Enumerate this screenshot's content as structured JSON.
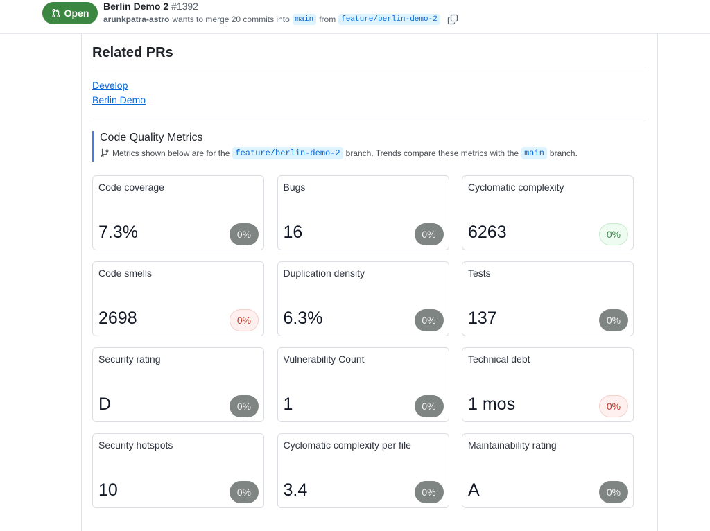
{
  "header": {
    "state": "Open",
    "state_icon": "git-pull-request-icon",
    "title": "Berlin Demo 2",
    "number": "#1392",
    "author": "arunkpatra-astro",
    "merge_text": "wants to merge 20 commits into",
    "base_branch": "main",
    "from_text": "from",
    "head_branch": "feature/berlin-demo-2",
    "copy_icon": "copy-icon"
  },
  "related": {
    "title": "Related PRs",
    "links": [
      "Develop",
      "Berlin Demo"
    ]
  },
  "code_quality": {
    "title": "Code Quality Metrics",
    "branch_icon": "git-branch-icon",
    "desc_prefix": "Metrics shown below are for the",
    "branch": "feature/berlin-demo-2",
    "desc_middle": "branch. Trends compare these metrics with the",
    "compare_branch": "main",
    "desc_suffix": "branch.",
    "colors": {
      "neutral": "#7f8582",
      "good": "#3d8b4a",
      "bad": "#c0392b",
      "accent": "#4a7ae8"
    },
    "metrics": [
      {
        "label": "Code coverage",
        "value": "7.3%",
        "trend": "0%",
        "trend_status": "neutral"
      },
      {
        "label": "Bugs",
        "value": "16",
        "trend": "0%",
        "trend_status": "neutral"
      },
      {
        "label": "Cyclomatic complexity",
        "value": "6263",
        "trend": "0%",
        "trend_status": "good"
      },
      {
        "label": "Code smells",
        "value": "2698",
        "trend": "0%",
        "trend_status": "bad"
      },
      {
        "label": "Duplication density",
        "value": "6.3%",
        "trend": "0%",
        "trend_status": "neutral"
      },
      {
        "label": "Tests",
        "value": "137",
        "trend": "0%",
        "trend_status": "neutral"
      },
      {
        "label": "Security rating",
        "value": "D",
        "trend": "0%",
        "trend_status": "neutral"
      },
      {
        "label": "Vulnerability Count",
        "value": "1",
        "trend": "0%",
        "trend_status": "neutral"
      },
      {
        "label": "Technical debt",
        "value": "1 mos",
        "trend": "0%",
        "trend_status": "bad"
      },
      {
        "label": "Security hotspots",
        "value": "10",
        "trend": "0%",
        "trend_status": "neutral"
      },
      {
        "label": "Cyclomatic complexity per file",
        "value": "3.4",
        "trend": "0%",
        "trend_status": "neutral"
      },
      {
        "label": "Maintainability rating",
        "value": "A",
        "trend": "0%",
        "trend_status": "neutral"
      }
    ]
  }
}
